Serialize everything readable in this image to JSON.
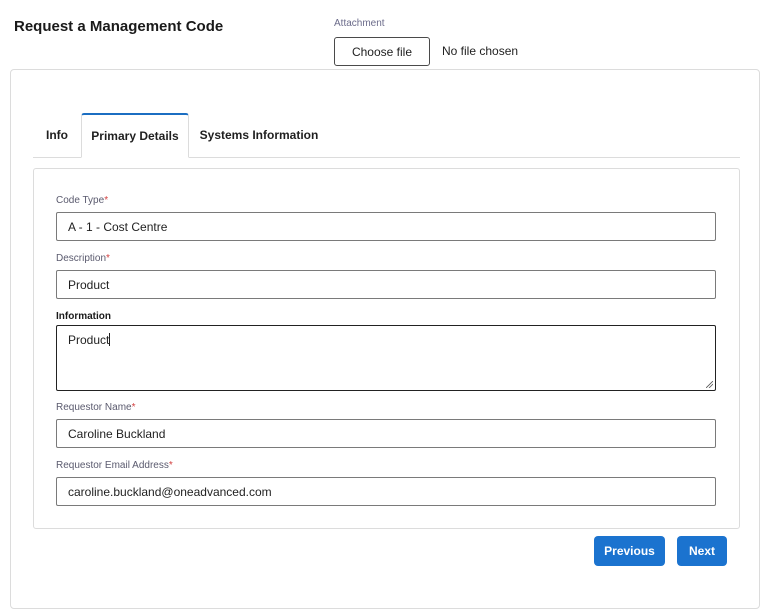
{
  "header": {
    "title": "Request a Management Code"
  },
  "attachment": {
    "label": "Attachment",
    "button_label": "Choose file",
    "status": "No file chosen"
  },
  "tabs": [
    {
      "label": "Info",
      "active": false
    },
    {
      "label": "Primary Details",
      "active": true
    },
    {
      "label": "Systems Information",
      "active": false
    }
  ],
  "form": {
    "code_type": {
      "label": "Code Type",
      "required_mark": "*",
      "value": "A - 1 - Cost Centre"
    },
    "description": {
      "label": "Description",
      "required_mark": "*",
      "value": "Product"
    },
    "information": {
      "label": "Information",
      "value": "Product"
    },
    "requestor_name": {
      "label": "Requestor Name",
      "required_mark": "*",
      "value": "Caroline Buckland"
    },
    "requestor_email": {
      "label": "Requestor Email Address",
      "required_mark": "*",
      "value": "caroline.buckland@oneadvanced.com"
    }
  },
  "actions": {
    "previous_label": "Previous",
    "next_label": "Next"
  },
  "colors": {
    "accent": "#1b73cf",
    "required": "#d23f3f",
    "tab_active_border": "#1b6ec2"
  }
}
